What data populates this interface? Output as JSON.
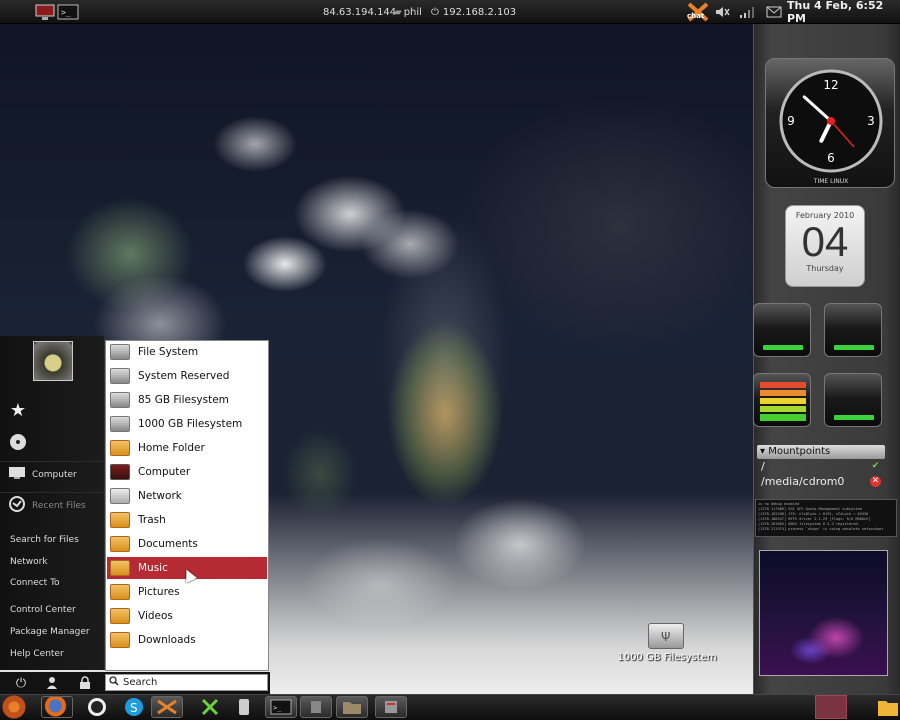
{
  "top_panel": {
    "ip_public": "84.63.194.144",
    "user": "phil",
    "ip_local": "192.168.2.103",
    "clock": "Thu  4 Feb,  6:52 PM",
    "icons": [
      "computer-icon",
      "terminal-icon",
      "chat-icon",
      "volume-icon",
      "network-signal-icon",
      "mail-icon"
    ]
  },
  "side_widgets": {
    "clock": {
      "numbers": [
        "12",
        "3",
        "6",
        "9"
      ],
      "brand": "TIME",
      "brand2": "LINUX",
      "hour_hand_hours": 6,
      "minute_hand_minutes": 52
    },
    "calendar": {
      "month": "February 2010",
      "day": "04",
      "weekday": "Thursday"
    },
    "mountpoints": {
      "header": "▾ Mountpoints",
      "items": [
        {
          "path": "/",
          "status": "mounted"
        },
        {
          "path": "/media/cdrom0",
          "status": "unmounted"
        }
      ]
    },
    "log_lines": [
      "is no debug enabled",
      "[1378.117066] SGI XFS Quota Management subsystem",
      "[1378.182208] JFS: nTxBlock = 8192, nTxLock = 65536",
      "[1378.188547] NTFS driver 2.1.29 [Flags: R/O MODULE]",
      "[1378.201005] QNX4 filesystem 0.2.3 registered.",
      "[1378.211974] process `skype' is using obsolete setsockopt"
    ]
  },
  "desktop": {
    "drive_icon_label": "1000 GB Filesystem"
  },
  "menu": {
    "left": {
      "computer_label": "Computer",
      "recent_label": "Recent Files",
      "links": [
        "Search for Files",
        "Network",
        "Connect To",
        "Control Center",
        "Package Manager",
        "Help Center"
      ]
    },
    "places": [
      {
        "label": "File System",
        "icon": "drive-icon"
      },
      {
        "label": "System Reserved",
        "icon": "drive-icon"
      },
      {
        "label": "85 GB Filesystem",
        "icon": "drive-icon"
      },
      {
        "label": "1000 GB Filesystem",
        "icon": "usb-drive-icon"
      },
      {
        "label": "Home Folder",
        "icon": "home-folder-icon"
      },
      {
        "label": "Computer",
        "icon": "computer-icon"
      },
      {
        "label": "Network",
        "icon": "network-icon"
      },
      {
        "label": "Trash",
        "icon": "trash-icon"
      },
      {
        "label": "Documents",
        "icon": "folder-icon"
      },
      {
        "label": "Music",
        "icon": "music-folder-icon",
        "selected": true
      },
      {
        "label": "Pictures",
        "icon": "folder-icon"
      },
      {
        "label": "Videos",
        "icon": "folder-icon"
      },
      {
        "label": "Downloads",
        "icon": "folder-icon"
      }
    ],
    "search_placeholder": "Search",
    "bottom_buttons": [
      "power-icon",
      "user-icon",
      "lock-icon"
    ]
  },
  "taskbar": {
    "items": [
      "ubuntu-logo-icon",
      "firefox-icon",
      "app-icon",
      "skype-icon",
      "chat-icon",
      "tools-icon",
      "app-icon",
      "terminal-icon",
      "app-icon",
      "folder-icon",
      "app-icon"
    ],
    "accent": "#b62b33"
  }
}
